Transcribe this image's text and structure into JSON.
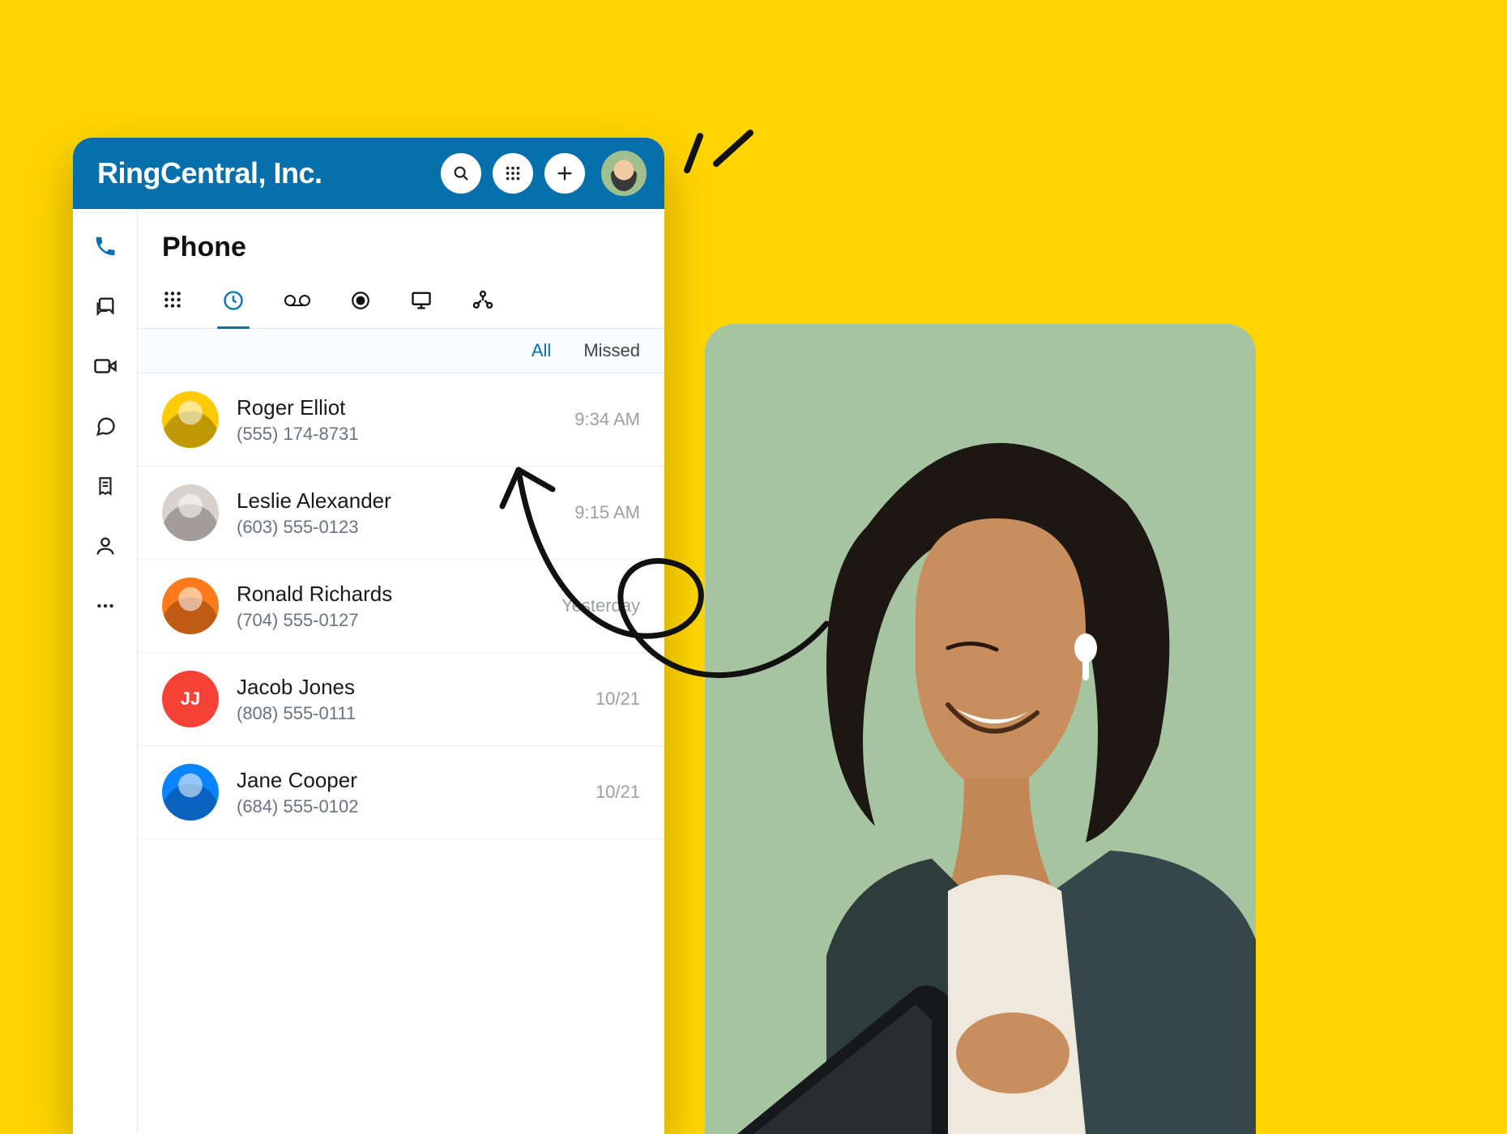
{
  "header": {
    "title": "RingCentral, Inc."
  },
  "section_title": "Phone",
  "filters": {
    "all": "All",
    "missed": "Missed"
  },
  "rail": {
    "phone": "phone-icon",
    "messages": "messages-icon",
    "video": "video-icon",
    "chat": "chat-icon",
    "notes": "notes-icon",
    "contacts": "contacts-icon",
    "more": "more-icon"
  },
  "subtabs": {
    "dialpad": "dialpad-icon",
    "recent": "recent-icon",
    "voicemail": "voicemail-icon",
    "recordings": "recordings-icon",
    "hud": "hud-icon",
    "conference": "conference-icon"
  },
  "calls": [
    {
      "name": "Roger Elliot",
      "number": "(555) 174-8731",
      "time": "9:34 AM",
      "avatar_bg": "#ffcb05",
      "initials": ""
    },
    {
      "name": "Leslie Alexander",
      "number": "(603) 555-0123",
      "time": "9:15 AM",
      "avatar_bg": "#d9d2cc",
      "initials": ""
    },
    {
      "name": "Ronald Richards",
      "number": "(704) 555-0127",
      "time": "Yesterday",
      "avatar_bg": "#ff7a1a",
      "initials": ""
    },
    {
      "name": "Jacob Jones",
      "number": "(808) 555-0111",
      "time": "10/21",
      "avatar_bg": "#f44336",
      "initials": "JJ"
    },
    {
      "name": "Jane Cooper",
      "number": "(684) 555-0102",
      "time": "10/21",
      "avatar_bg": "#0a84ff",
      "initials": ""
    }
  ]
}
